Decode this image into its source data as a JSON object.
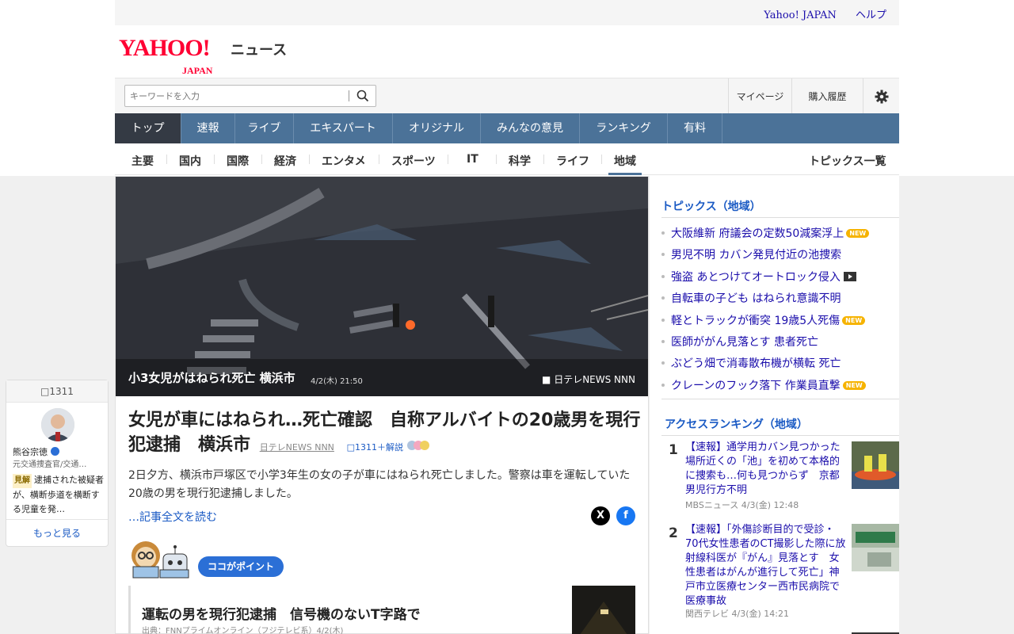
{
  "utility": {
    "yahoo_japan": "Yahoo! JAPAN",
    "help": "ヘルプ"
  },
  "logo": {
    "main": "YAHOO!",
    "sub_small": "JAPAN",
    "service": "ニュース"
  },
  "search": {
    "placeholder": "キーワードを入力"
  },
  "header_buttons": {
    "mypage": "マイページ",
    "purchase": "購入履歴"
  },
  "nav": [
    "トップ",
    "速報",
    "ライブ",
    "エキスパート",
    "オリジナル",
    "みんなの意見",
    "ランキング",
    "有料"
  ],
  "subnav": [
    "主要",
    "国内",
    "国際",
    "経済",
    "エンタメ",
    "スポーツ",
    "IT",
    "科学",
    "ライフ",
    "地域"
  ],
  "subnav_all": "トピックス一覧",
  "hero": {
    "caption": "小3女児がはねられ死亡 横浜市",
    "date": "4/2(木) 21:50",
    "source": "日テレNEWS NNN"
  },
  "article": {
    "headline": "女児が車にはねられ…死亡確認　自称アルバイトの20歳男を現行犯逮捕　横浜市",
    "source": "日テレNEWS NNN",
    "comments": "1311＋解説",
    "summary": "2日夕方、横浜市戸塚区で小学3年生の女の子が車にはねられ死亡しました。警察は車を運転していた20歳の男を現行犯逮捕しました。",
    "read_more": "…記事全文を読む",
    "share_x": "X",
    "share_fb": "f"
  },
  "point": {
    "badge": "ココがポイント"
  },
  "related": {
    "title": "運転の男を現行犯逮捕　信号機のないT字路で",
    "meta": "出典：FNNプライムオンライン（フジテレビ系）4/2(木)"
  },
  "expert": {
    "count": "1311",
    "name": "熊谷宗徳",
    "title": "元交通捜査官/交通…",
    "tag": "見解",
    "comment": "逮捕された被疑者が、横断歩道を横断する児童を発…",
    "more": "もっと見る"
  },
  "topics": {
    "heading": "トピックス（地域）",
    "items": [
      {
        "text": "大阪維新 府議会の定数50減案浮上",
        "badge": "NEW"
      },
      {
        "text": "男児不明 カバン発見付近の池捜索",
        "badge": ""
      },
      {
        "text": "強盗 あとつけてオートロック侵入",
        "badge": ""
      },
      {
        "text": "自転車の子ども はねられ意識不明",
        "badge": ""
      },
      {
        "text": "軽とトラックが衝突 19歳5人死傷",
        "badge": "NEW"
      },
      {
        "text": "医師ががん見落とす 患者死亡",
        "badge": ""
      },
      {
        "text": "ぶどう畑で消毒散布機が横転 死亡",
        "badge": ""
      },
      {
        "text": "クレーンのフック落下 作業員直撃",
        "badge": "NEW"
      }
    ]
  },
  "ranking": {
    "heading": "アクセスランキング（地域）",
    "items": [
      {
        "rank": "1",
        "title": "【速報】通学用カバン見つかった場所近くの「池」を初めて本格的に捜索も…何も見つからず　京都 男児行方不明",
        "meta": "MBSニュース 4/3(金) 12:48"
      },
      {
        "rank": "2",
        "title": "【速報】「外傷診断目的で受診・70代女性患者のCT撮影した際に放射線科医が『がん』見落とす　女性患者はがんが進行して死亡」神戸市立医療センター西市民病院で医療事故",
        "meta": "関西テレビ 4/3(金) 14:21"
      }
    ]
  },
  "colors": {
    "nav": "#4b7298",
    "nav_active": "#343a44",
    "link": "#1a0dab",
    "accent": "#1a5ac4",
    "logo": "#ff0033"
  }
}
